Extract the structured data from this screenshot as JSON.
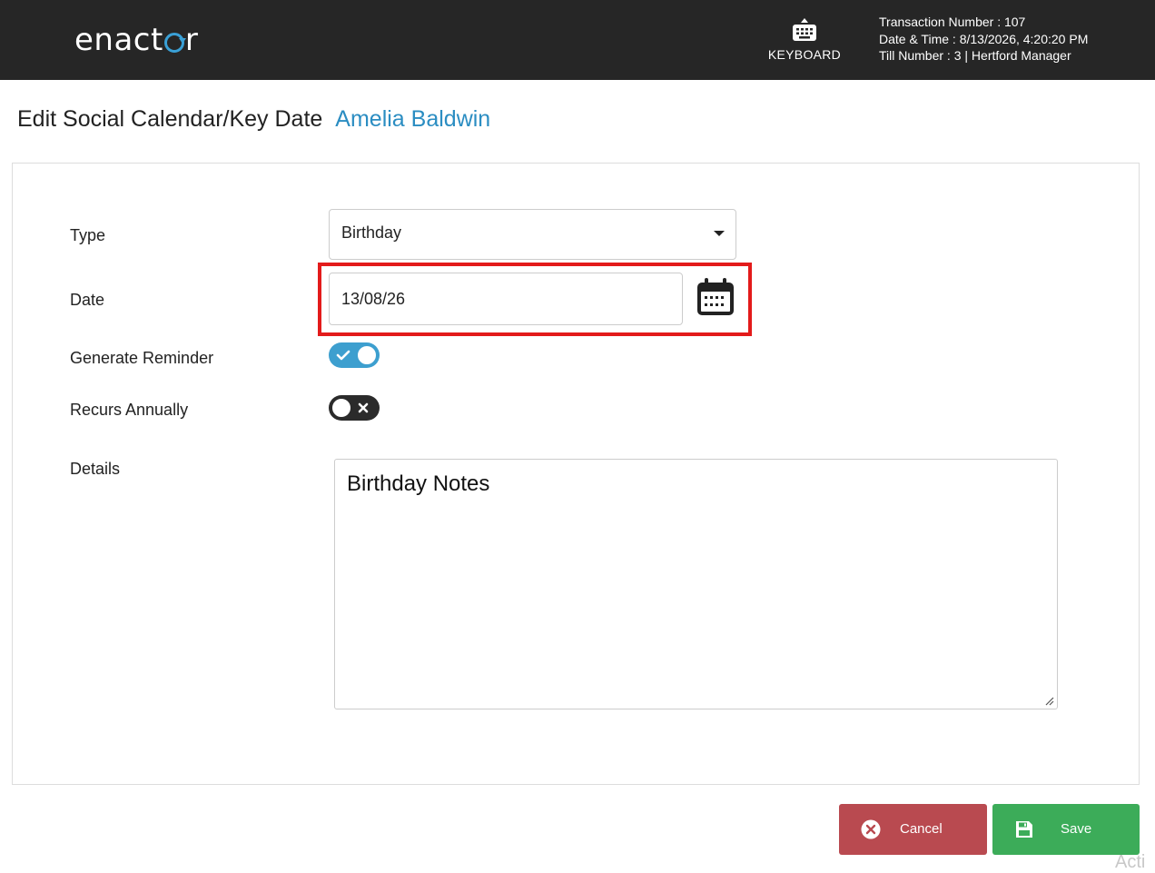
{
  "header": {
    "brand": {
      "prefix": "enact",
      "suffix": "r"
    },
    "keyboard_label": "KEYBOARD",
    "keyboard_icon": "keyboard-icon",
    "transaction_number": "Transaction Number : 107",
    "date_time": "Date & Time : 8/13/2026, 4:20:20 PM",
    "till_info": "Till Number : 3  |  Hertford Manager"
  },
  "page": {
    "title": "Edit Social Calendar/Key Date",
    "customer_name": "Amelia Baldwin"
  },
  "form": {
    "type": {
      "label": "Type",
      "value": "Birthday"
    },
    "date": {
      "label": "Date",
      "value": "13/08/26",
      "icon": "calendar-icon"
    },
    "generate_reminder": {
      "label": "Generate Reminder",
      "checked": true
    },
    "recurs_annually": {
      "label": "Recurs Annually",
      "checked": false
    },
    "details": {
      "label": "Details",
      "value": "Birthday Notes"
    }
  },
  "actions": {
    "cancel_label": "Cancel",
    "save_label": "Save"
  },
  "watermark": "Acti",
  "colors": {
    "header_bg": "#262626",
    "accent": "#2b8dc2",
    "toggle_on": "#3d9fcf",
    "highlight": "#e31b1b",
    "cancel": "#b94a50",
    "save": "#3cac59"
  }
}
